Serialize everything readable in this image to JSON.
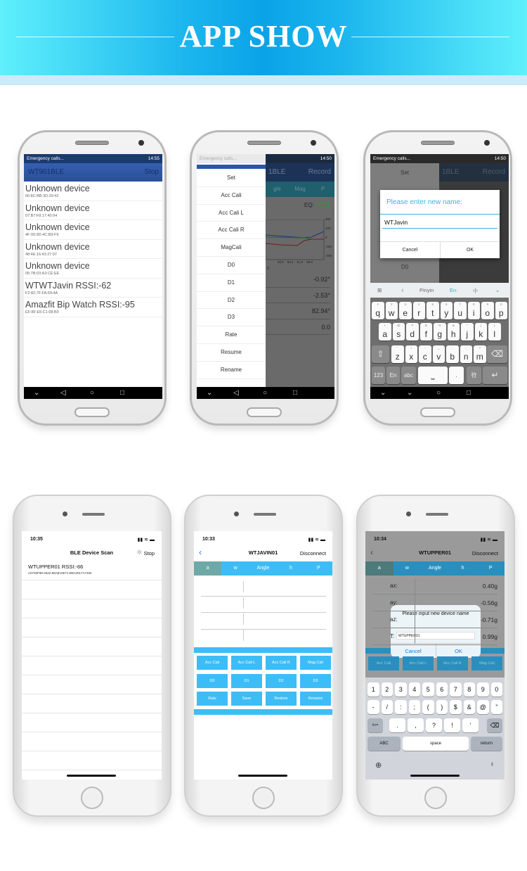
{
  "banner": {
    "title": "APP SHOW"
  },
  "android1": {
    "status": {
      "left": "Emergency calls...",
      "time": "14:55"
    },
    "header": {
      "title": "WT901BLE",
      "action": "Stop"
    },
    "devices": [
      {
        "name": "Unknown device",
        "mac": "66:8C:BB:3D:33:42"
      },
      {
        "name": "Unknown device",
        "mac": "07:B7:F8:17:40:94"
      },
      {
        "name": "Unknown device",
        "mac": "4F:00:9D:4C:B9:F9"
      },
      {
        "name": "Unknown device",
        "mac": "48:4E:16:43:27:07"
      },
      {
        "name": "Unknown device",
        "mac": "05:7B:03:A3:CE:EE"
      },
      {
        "name": "WTWTJavin  RSSI:-62",
        "mac": "F2:82:7F:FA:59:4A"
      },
      {
        "name": "Amazfit Bip Watch  RSSI:-95",
        "mac": "EF:8F:E5:C1:08:B0"
      }
    ]
  },
  "android2": {
    "status": {
      "left": "Emergency calls...",
      "time": "14:50"
    },
    "header": {
      "title": "1BLE",
      "action": "Record"
    },
    "tabs": [
      "gle",
      "Mag",
      "P"
    ],
    "eq_label": "EQ:",
    "chart": {
      "y_ticks": [
        "200",
        "100",
        "0",
        "-100",
        "-200"
      ],
      "x_ticks": [
        "50.9",
        "50.4",
        "51.0",
        "50.6"
      ],
      "x_label": "Z"
    },
    "values": [
      "-0.92°",
      "-2.53°",
      "82.94°",
      "0.0"
    ],
    "drawer": [
      "Set",
      "Acc Cali",
      "Acc Cali L",
      "Acc Cali R",
      "MagCali",
      "D0",
      "D1",
      "D2",
      "D3",
      "Rate",
      "Resume",
      "Rename"
    ]
  },
  "android3": {
    "status": {
      "left": "Emergency calls...",
      "time": "14:50"
    },
    "header": {
      "title": "1BLE",
      "action": "Record"
    },
    "drawer_visible": [
      "Set",
      "D0"
    ],
    "dialog": {
      "title": "Please enter new name:",
      "value": "WTJavin",
      "cancel": "Cancel",
      "ok": "OK"
    },
    "keyboard": {
      "toolbar": [
        "Pinyin",
        "En·"
      ],
      "row1": {
        "keys": [
          "q",
          "w",
          "e",
          "r",
          "t",
          "y",
          "u",
          "i",
          "o",
          "p"
        ],
        "hints": [
          "1",
          "2",
          "3",
          "4",
          "5",
          "6",
          "7",
          "8",
          "9",
          "0"
        ]
      },
      "row2": {
        "keys": [
          "a",
          "s",
          "d",
          "f",
          "g",
          "h",
          "j",
          "k",
          "l"
        ],
        "hints": [
          "!",
          "@",
          "#",
          "$",
          "%",
          "&",
          "*",
          "(",
          ")"
        ]
      },
      "row3": {
        "keys": [
          "z",
          "x",
          "c",
          "v",
          "b",
          "n",
          "m"
        ],
        "hints": [
          "'",
          "/",
          "-",
          "_",
          ":",
          ";",
          "?"
        ]
      },
      "bottom": [
        "123",
        "En",
        "abc",
        ".",
        "符"
      ]
    }
  },
  "ios1": {
    "time": "10:35",
    "title": "BLE Device Scan",
    "action": "Stop",
    "devices": [
      {
        "name": "WTUPPER01 RSSI:-66",
        "uuid": "A0729F98-2522-86AB-DE71-B9A2017A7450"
      }
    ]
  },
  "ios2": {
    "time": "10:33",
    "title": "WTJAVIN01",
    "action": "Disconnect",
    "tabs": [
      "a",
      "w",
      "Angle",
      "h",
      "P"
    ],
    "buttons": [
      "Acc Cali",
      "Acc Cali L",
      "Acc Cali R",
      "Mag Cali",
      "D0",
      "D1",
      "D2",
      "D3",
      "Rate",
      "Save",
      "Restore",
      "Rename"
    ]
  },
  "ios3": {
    "time": "10:34",
    "title": "WTUPPER01",
    "action": "Disconnect",
    "tabs": [
      "a",
      "w",
      "Angle",
      "h",
      "P"
    ],
    "rows": [
      {
        "label": "ax:",
        "value": "0.40g"
      },
      {
        "label": "ay:",
        "value": "-0.56g"
      },
      {
        "label": "az:",
        "value": "-0.71g"
      },
      {
        "label": "T:",
        "value": "0.99g"
      }
    ],
    "buttons": [
      "Acc Cali",
      "Acc Cali L",
      "Acc Cali R",
      "Mag Cali"
    ],
    "dialog": {
      "title": "Please input new device name",
      "value": "WTUPPER01",
      "cancel": "Cancel",
      "ok": "OK"
    },
    "keyboard": {
      "row1": [
        "1",
        "2",
        "3",
        "4",
        "5",
        "6",
        "7",
        "8",
        "9",
        "0"
      ],
      "row2": [
        "-",
        "/",
        ":",
        ";",
        "(",
        ")",
        "$",
        "&",
        "@",
        "”"
      ],
      "row3": [
        ".",
        ",",
        "?",
        "!",
        "'"
      ],
      "symbols": "#+=",
      "abc": "ABC",
      "space": "space",
      "return": "return"
    }
  },
  "colors": {
    "accent": "#3dbdf6",
    "android_header": "#2b4f98",
    "dialog_title": "#33b5e5"
  }
}
